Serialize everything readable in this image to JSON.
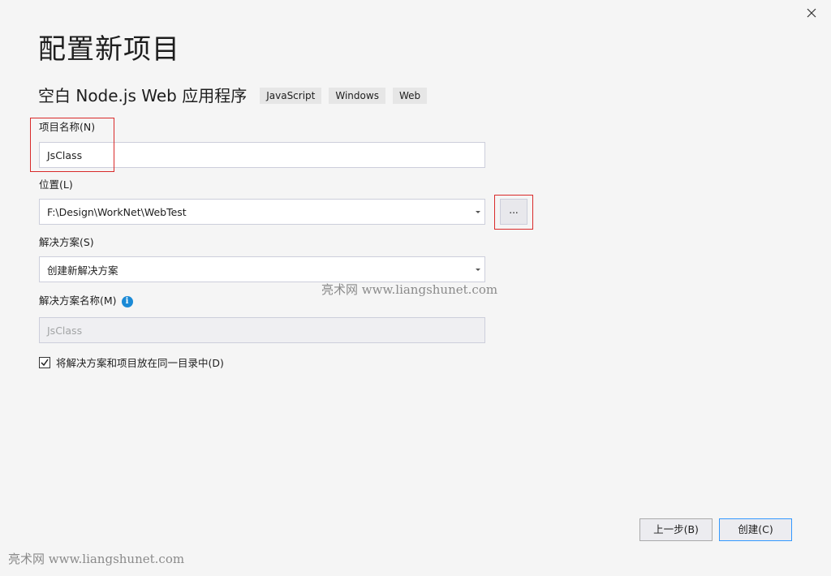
{
  "dialog": {
    "title": "配置新项目",
    "template_name": "空白 Node.js Web 应用程序",
    "tags": [
      "JavaScript",
      "Windows",
      "Web"
    ]
  },
  "form": {
    "project_name": {
      "label": "项目名称(N)",
      "value": "JsClass"
    },
    "location": {
      "label": "位置(L)",
      "value": "F:\\Design\\WorkNet\\WebTest",
      "browse_label": "..."
    },
    "solution": {
      "label": "解决方案(S)",
      "value": "创建新解决方案"
    },
    "solution_name": {
      "label": "解决方案名称(M)",
      "value": "JsClass",
      "info_glyph": "i"
    },
    "same_directory": {
      "label": "将解决方案和项目放在同一目录中(D)",
      "checked": true
    }
  },
  "buttons": {
    "back": "上一步(B)",
    "create": "创建(C)"
  },
  "watermarks": {
    "center": "亮术网 www.liangshunet.com",
    "bottom": "亮术网 www.liangshunet.com"
  },
  "colors": {
    "highlight_box": "#d92a2a",
    "primary_border": "#3399ff",
    "info_icon": "#1b8ad6"
  }
}
